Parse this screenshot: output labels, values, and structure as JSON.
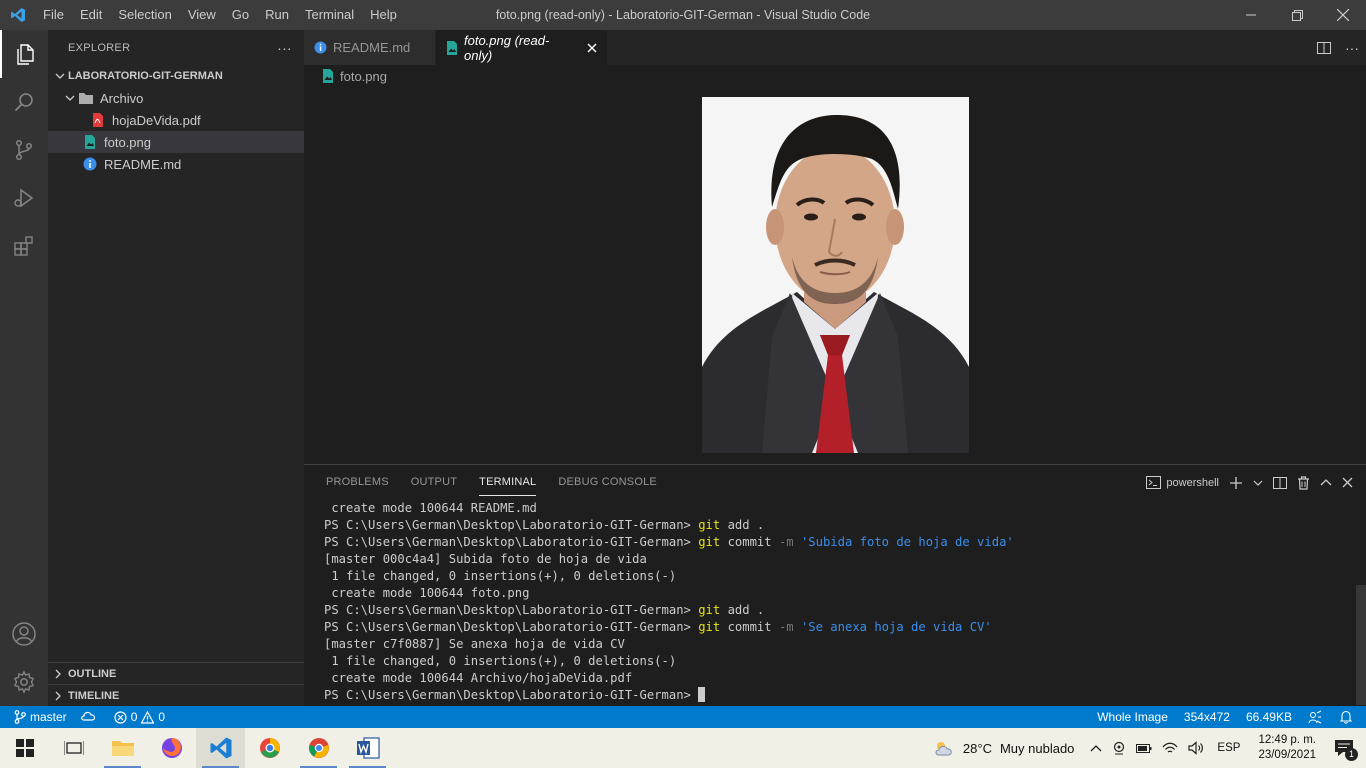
{
  "titlebar": {
    "menu": [
      "File",
      "Edit",
      "Selection",
      "View",
      "Go",
      "Run",
      "Terminal",
      "Help"
    ],
    "title": "foto.png (read-only) - Laboratorio-GIT-German - Visual Studio Code"
  },
  "sidebar": {
    "header": "EXPLORER",
    "more": "···",
    "root": "LABORATORIO-GIT-GERMAN",
    "items": [
      {
        "label": "Archivo",
        "icon": "folder-icon"
      },
      {
        "label": "hojaDeVida.pdf",
        "icon": "pdf-file-icon"
      },
      {
        "label": "foto.png",
        "icon": "image-file-icon"
      },
      {
        "label": "README.md",
        "icon": "info-file-icon"
      }
    ],
    "outline": "OUTLINE",
    "timeline": "TIMELINE"
  },
  "editor": {
    "tabs": [
      {
        "label": "README.md",
        "icon": "info-file-icon"
      },
      {
        "label": "foto.png (read-only)",
        "icon": "image-file-icon"
      }
    ],
    "breadcrumb": "foto.png"
  },
  "panel": {
    "tabs": [
      "PROBLEMS",
      "OUTPUT",
      "TERMINAL",
      "DEBUG CONSOLE"
    ],
    "shell": "powershell",
    "lines": [
      {
        "text": " create mode 100644 README.md"
      },
      {
        "prompt": "PS C:\\Users\\German\\Desktop\\Laboratorio-GIT-German> ",
        "cmd": "git",
        "rest": " add ."
      },
      {
        "prompt": "PS C:\\Users\\German\\Desktop\\Laboratorio-GIT-German> ",
        "cmd": "git",
        "rest": " commit ",
        "flag": "-m",
        "str": " 'Subida foto de hoja de vida'"
      },
      {
        "text": "[master 000c4a4] Subida foto de hoja de vida"
      },
      {
        "text": " 1 file changed, 0 insertions(+), 0 deletions(-)"
      },
      {
        "text": " create mode 100644 foto.png"
      },
      {
        "prompt": "PS C:\\Users\\German\\Desktop\\Laboratorio-GIT-German> ",
        "cmd": "git",
        "rest": " add ."
      },
      {
        "prompt": "PS C:\\Users\\German\\Desktop\\Laboratorio-GIT-German> ",
        "cmd": "git",
        "rest": " commit ",
        "flag": "-m",
        "str": " 'Se anexa hoja de vida CV'"
      },
      {
        "text": "[master c7f0887] Se anexa hoja de vida CV"
      },
      {
        "text": " 1 file changed, 0 insertions(+), 0 deletions(-)"
      },
      {
        "text": " create mode 100644 Archivo/hojaDeVida.pdf"
      },
      {
        "prompt": "PS C:\\Users\\German\\Desktop\\Laboratorio-GIT-German> ",
        "cursor": true
      }
    ]
  },
  "statusbar": {
    "branch": "master",
    "errors": "0",
    "warnings": "0",
    "image_mode": "Whole Image",
    "dimensions": "354x472",
    "size": "66.49KB"
  },
  "taskbar": {
    "weather_temp": "28°C",
    "weather_desc": "Muy nublado",
    "lang": "ESP",
    "time": "12:49 p. m.",
    "date": "23/09/2021",
    "notif_count": "1"
  }
}
